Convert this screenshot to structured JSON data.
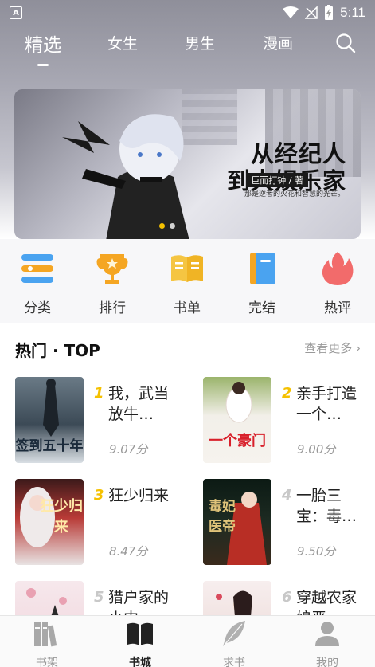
{
  "status_bar": {
    "app_glyph": "A",
    "time": "5:11"
  },
  "top_tabs": [
    {
      "label": "精选",
      "active": true
    },
    {
      "label": "女生",
      "active": false
    },
    {
      "label": "男生",
      "active": false
    },
    {
      "label": "漫画",
      "active": false
    }
  ],
  "banner": {
    "title_line1": "从经纪人",
    "title_line2": "到大娱乐家",
    "author": "巨而打钟 / 著",
    "slogan": "那是逆者的火花和智慧的光芒。",
    "slide_count": 2,
    "active_slide": 0
  },
  "quick_links": [
    {
      "label": "分类",
      "icon": "category-icon"
    },
    {
      "label": "排行",
      "icon": "trophy-icon"
    },
    {
      "label": "书单",
      "icon": "booklist-icon"
    },
    {
      "label": "完结",
      "icon": "finished-book-icon"
    },
    {
      "label": "热评",
      "icon": "flame-icon"
    }
  ],
  "section": {
    "title": "热门 · TOP",
    "more": "查看更多"
  },
  "books": [
    {
      "rank": "1",
      "title": "我，武当放牛…",
      "score": "9.07分",
      "cover_text": "签到五十年",
      "rank_color": "#f5c100"
    },
    {
      "rank": "2",
      "title": "亲手打造一个…",
      "score": "9.00分",
      "cover_text": "一个豪门",
      "rank_color": "#f5c100"
    },
    {
      "rank": "3",
      "title": "狂少归来",
      "score": "8.47分",
      "cover_text": "狂少归来",
      "rank_color": "#f5c100"
    },
    {
      "rank": "4",
      "title": "一胎三宝：毒…",
      "score": "9.50分",
      "cover_text": "毒妃医帝",
      "rank_color": "#c8c8c8"
    },
    {
      "rank": "5",
      "title": "猎户家的小内…",
      "score": "",
      "cover_text": "",
      "rank_color": "#c8c8c8"
    },
    {
      "rank": "6",
      "title": "穿越农家娘恶…",
      "score": "",
      "cover_text": "",
      "rank_color": "#c8c8c8"
    }
  ],
  "bottom_nav": [
    {
      "label": "书架",
      "icon": "bookshelf-icon",
      "active": false
    },
    {
      "label": "书城",
      "icon": "bookstore-icon",
      "active": true
    },
    {
      "label": "求书",
      "icon": "feather-icon",
      "active": false
    },
    {
      "label": "我的",
      "icon": "profile-icon",
      "active": false
    }
  ]
}
